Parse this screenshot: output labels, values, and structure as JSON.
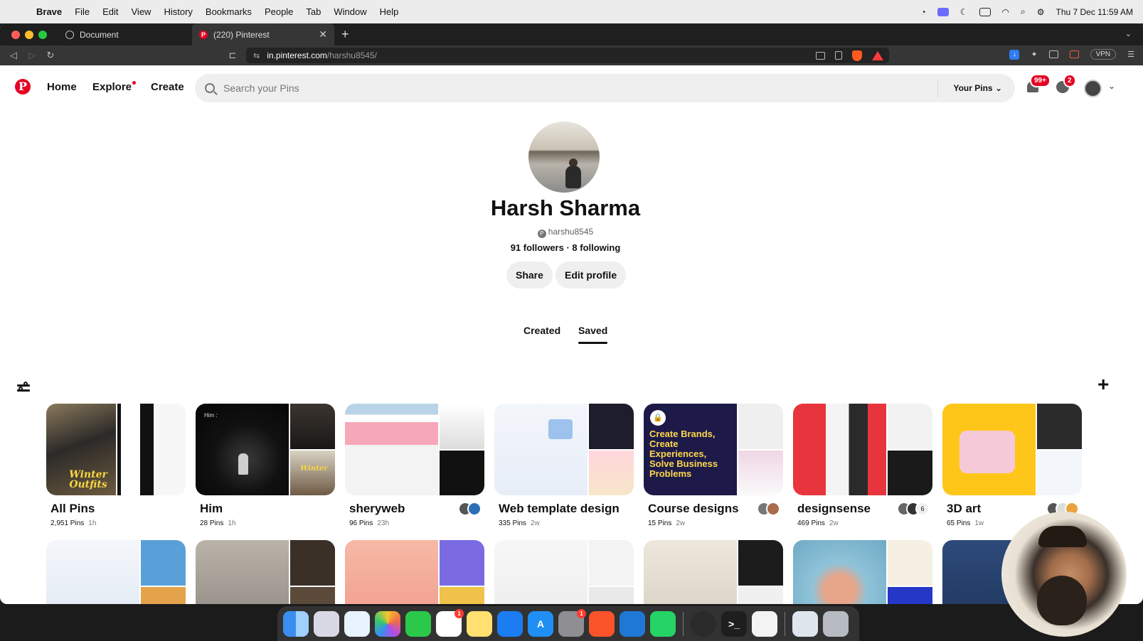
{
  "menubar": {
    "items": [
      "Brave",
      "File",
      "Edit",
      "View",
      "History",
      "Bookmarks",
      "People",
      "Tab",
      "Window",
      "Help"
    ],
    "clock": "Thu 7 Dec  11:59 AM"
  },
  "browser": {
    "tabs": [
      {
        "title": "Document"
      },
      {
        "title": "(220) Pinterest"
      }
    ],
    "url_host": "in.pinterest.com",
    "url_path": "/harshu8545/",
    "shield_count": "1",
    "vpn_label": "VPN"
  },
  "pinterest": {
    "nav": {
      "home": "Home",
      "explore": "Explore",
      "create": "Create",
      "search_placeholder": "Search your Pins",
      "your_pins": "Your Pins",
      "notif_badge": "99+",
      "msg_badge": "2"
    },
    "profile": {
      "name": "Harsh Sharma",
      "handle": "harshu8545",
      "followers_line": "91 followers · 8 following",
      "share": "Share",
      "edit": "Edit profile"
    },
    "tabs": {
      "created": "Created",
      "saved": "Saved"
    },
    "boards": [
      {
        "title": "All Pins",
        "pins": "2,951 Pins",
        "time": "1h"
      },
      {
        "title": "Him",
        "pins": "28 Pins",
        "time": "1h"
      },
      {
        "title": "sheryweb",
        "pins": "96 Pins",
        "time": "23h"
      },
      {
        "title": "Web template design",
        "pins": "335 Pins",
        "time": "2w"
      },
      {
        "title": "Course designs",
        "pins": "15 Pins",
        "time": "2w"
      },
      {
        "title": "designsense",
        "pins": "469 Pins",
        "time": "2w"
      },
      {
        "title": "3D art",
        "pins": "65 Pins",
        "time": "1w"
      }
    ],
    "overlay_text": {
      "winter1": "Winter Outfits",
      "winter2": "Winter",
      "course_art": "Create Brands, Create Experiences, Solve Business Problems",
      "him_text": "Him :",
      "collab_count": "6"
    }
  },
  "colors": {
    "pinterest_red": "#e60023",
    "page_bg": "#ffffff",
    "chip_bg": "#efefef"
  }
}
